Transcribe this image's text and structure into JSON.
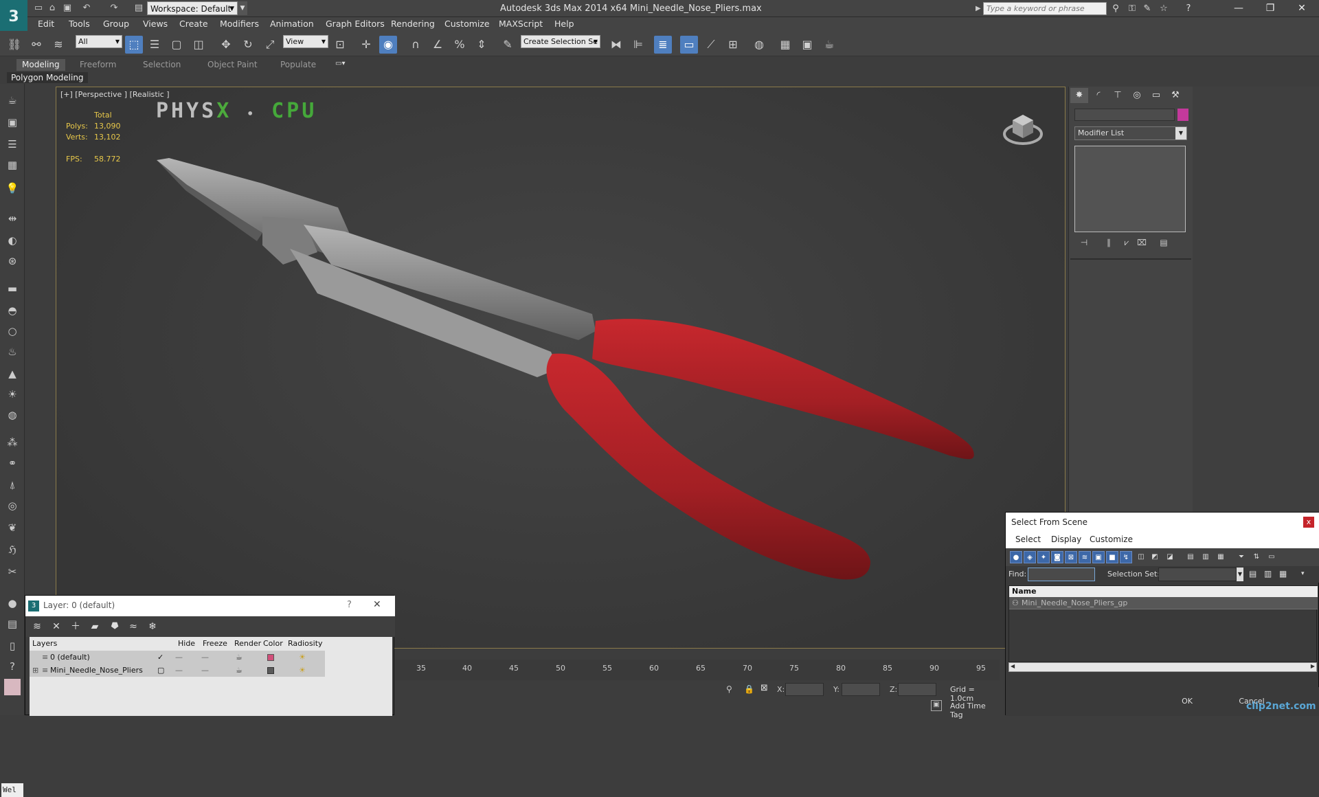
{
  "app": {
    "title": "Autodesk 3ds Max  2014 x64    Mini_Needle_Nose_Pliers.max",
    "logo_icon": "3ds-max-logo-icon"
  },
  "quick_access": {
    "workspace_label": "Workspace: Default",
    "search_placeholder": "Type a keyword or phrase"
  },
  "menu": [
    "Edit",
    "Tools",
    "Group",
    "Views",
    "Create",
    "Modifiers",
    "Animation",
    "Graph Editors",
    "Rendering",
    "Customize",
    "MAXScript",
    "Help"
  ],
  "toolbar": {
    "selection_filter": "All",
    "ref_coord": "View",
    "named_selection": "Create Selection Se"
  },
  "ribbon": {
    "tabs": [
      "Modeling",
      "Freeform",
      "Selection",
      "Object Paint",
      "Populate"
    ],
    "active_tab": "Modeling",
    "panel_label": "Polygon Modeling"
  },
  "viewport": {
    "label": "[+] [Perspective ] [Realistic ]",
    "physx_text_a": "PHYS",
    "physx_text_x": "X",
    "physx_text_sep": "•",
    "physx_text_cpu": "CPU",
    "stats": {
      "total_label": "Total",
      "polys_label": "Polys:",
      "polys_value": "13,090",
      "verts_label": "Verts:",
      "verts_value": "13,102",
      "fps_label": "FPS:",
      "fps_value": "58.772"
    },
    "handle_color": "#a82227",
    "metal_color": "#8a8a8a"
  },
  "command_panel": {
    "modifier_list": "Modifier List",
    "object_color": "#c4399c"
  },
  "timeline": {
    "ticks": [
      "35",
      "40",
      "45",
      "50",
      "55",
      "60",
      "65",
      "70",
      "75",
      "80",
      "85",
      "90",
      "95"
    ]
  },
  "status": {
    "x_label": "X:",
    "y_label": "Y:",
    "z_label": "Z:",
    "grid": "Grid = 1.0cm",
    "add_time_tag": "Add Time Tag",
    "maxscript_listener": "Wel"
  },
  "layer_dialog": {
    "title": "Layer: 0 (default)",
    "help": "?",
    "close": "✕",
    "columns": [
      "Layers",
      "Hide",
      "Freeze",
      "Render",
      "Color",
      "Radiosity"
    ],
    "rows": [
      {
        "name": "0 (default)",
        "color": "#d14f7a"
      },
      {
        "name": "Mini_Needle_Nose_Pliers",
        "color": "#5a5a5a"
      }
    ]
  },
  "select_from_scene": {
    "title": "Select From Scene",
    "close": "x",
    "menu": [
      "Select",
      "Display",
      "Customize"
    ],
    "find_label": "Find:",
    "selection_set_label": "Selection Set:",
    "column_name": "Name",
    "items": [
      "Mini_Needle_Nose_Pliers_gp"
    ],
    "ok": "OK",
    "cancel": "Cancel"
  },
  "watermark": "clip2net.com"
}
